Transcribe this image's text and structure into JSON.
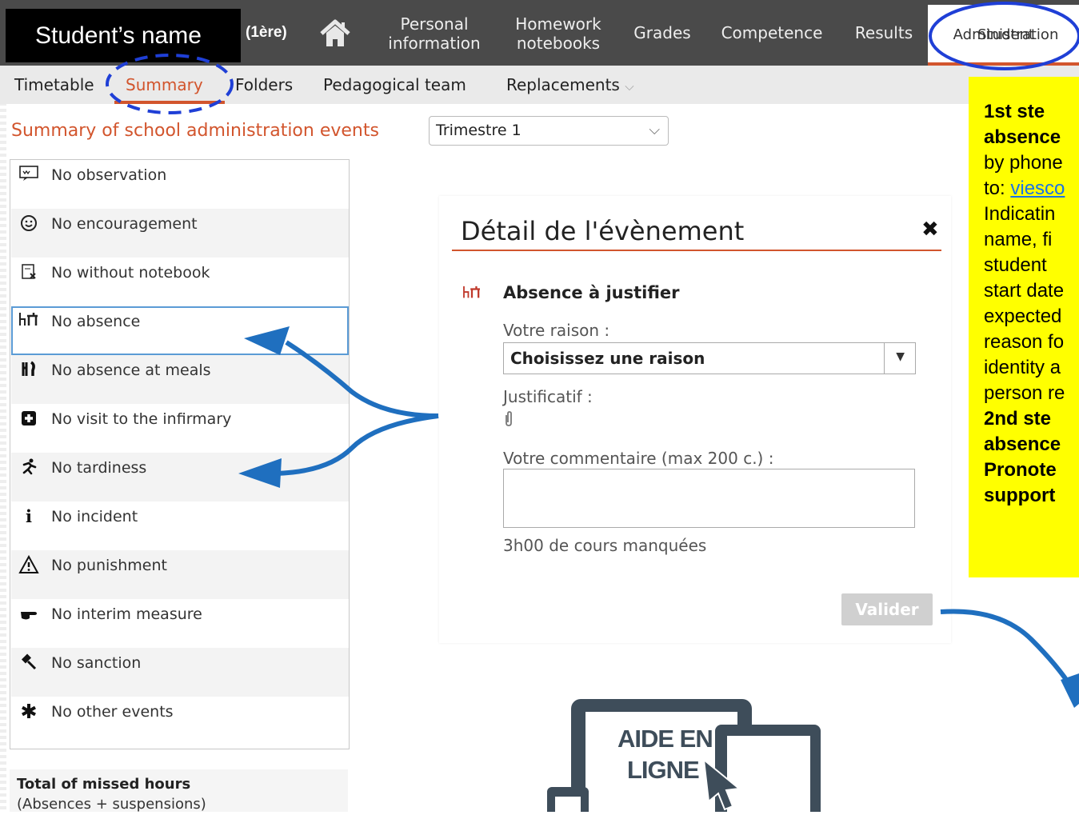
{
  "header": {
    "student_name": "Student’s name",
    "grade": "(1ère)",
    "nav": [
      {
        "line1": "Personal",
        "line2": "information"
      },
      {
        "line1": "Homework",
        "line2": "notebooks"
      },
      {
        "line1": "Grades",
        "line2": ""
      },
      {
        "line1": "Competence",
        "line2": ""
      },
      {
        "line1": "Results",
        "line2": ""
      }
    ],
    "active_tab": {
      "line1": "Student",
      "line2": "Administration"
    }
  },
  "subnav": {
    "items": [
      "Timetable",
      "Summary",
      "Folders",
      "Pedagogical team",
      "Replacements"
    ],
    "dropdown_chevron": "⌵"
  },
  "section": {
    "title": "Summary of school administration events",
    "period": "Trimestre 1",
    "period_chevron": "⌵"
  },
  "events": [
    {
      "icon": "observation-icon",
      "label": "No observation"
    },
    {
      "icon": "smiley-icon",
      "label": "No encouragement"
    },
    {
      "icon": "notebook-icon",
      "label": "No without notebook"
    },
    {
      "icon": "absence-desk-icon",
      "label": "No absence"
    },
    {
      "icon": "fork-knife-icon",
      "label": "No absence at meals"
    },
    {
      "icon": "medical-cross-icon",
      "label": "No visit to the infirmary"
    },
    {
      "icon": "running-icon",
      "label": "No tardiness"
    },
    {
      "icon": "info-icon",
      "label": "No incident"
    },
    {
      "icon": "warning-icon",
      "label": "No punishment"
    },
    {
      "icon": "pointing-hand-icon",
      "label": "No interim measure"
    },
    {
      "icon": "gavel-icon",
      "label": "No sanction"
    },
    {
      "icon": "asterisk-icon",
      "label": "No other events"
    }
  ],
  "totals": {
    "title": "Total of missed hours",
    "subtitle": "(Absences + suspensions)"
  },
  "modal": {
    "title": "Détail de l'évènement",
    "close": "✖",
    "event_title": "Absence à justifier",
    "reason_label": "Votre raison :",
    "reason_value": "Choisissez une raison",
    "proof_label": "Justificatif :",
    "comment_label": "Votre commentaire (max 200 c.) :",
    "missed": "3h00 de cours manquées",
    "submit": "Valider"
  },
  "help": {
    "line1": "AIDE EN",
    "line2": "LIGNE"
  },
  "note": {
    "l1": "1st ste",
    "l2": "absence",
    "l3": "by phone",
    "l4a": "to: ",
    "l4b": "viesco",
    "l5": "Indicatin",
    "l6": "name, fi",
    "l7": "student",
    "l8": "start date",
    "l9": "expected",
    "l10": "reason fo",
    "l11": "identity a",
    "l12": "person re",
    "l13": "2nd ste",
    "l14": "absence",
    "l15": "Pronote",
    "l16": "support"
  },
  "colors": {
    "accent": "#d2552d",
    "topbar": "#4a4a4a",
    "annotation_blue": "#1f6fbf",
    "note_yellow": "#ffff00"
  }
}
